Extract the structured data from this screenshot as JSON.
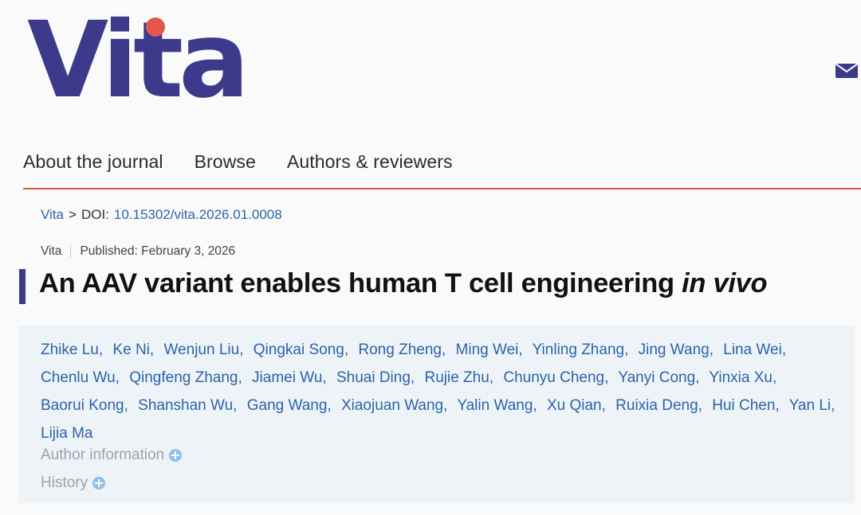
{
  "brand": {
    "logo_text": "Vita",
    "colors": {
      "primary": "#3d3a8c",
      "accent": "#e2574c",
      "link": "#2b64a8",
      "rule": "#d9583e"
    }
  },
  "header": {
    "mail_icon": "envelope-icon"
  },
  "nav": {
    "items": [
      "About the journal",
      "Browse",
      "Authors & reviewers"
    ]
  },
  "breadcrumb": {
    "home": "Vita",
    "separator": ">",
    "doi_label": "DOI:",
    "doi": "10.15302/vita.2026.01.0008"
  },
  "meta": {
    "journal": "Vita",
    "published": "Published: February 3, 2026"
  },
  "article": {
    "title_main": "An AAV variant enables human T cell engineering ",
    "title_italic": "in vivo",
    "authors": [
      "Zhike Lu,",
      "Ke Ni,",
      "Wenjun Liu,",
      "Qingkai Song,",
      "Rong Zheng,",
      "Ming Wei,",
      "Yinling Zhang,",
      "Jing Wang,",
      "Lina Wei,",
      "Chenlu Wu,",
      "Qingfeng Zhang,",
      "Jiamei Wu,",
      "Shuai Ding,",
      "Rujie Zhu,",
      "Chunyu Cheng,",
      "Yanyi Cong,",
      "Yinxia Xu,",
      "Baorui Kong,",
      "Shanshan Wu,",
      "Gang Wang,",
      "Xiaojuan Wang,",
      "Yalin Wang,",
      "Xu Qian,",
      "Ruixia Deng,",
      "Hui Chen,",
      "Yan Li,",
      "Lijia Ma"
    ],
    "author_information_label": "Author information",
    "history_label": "History"
  }
}
